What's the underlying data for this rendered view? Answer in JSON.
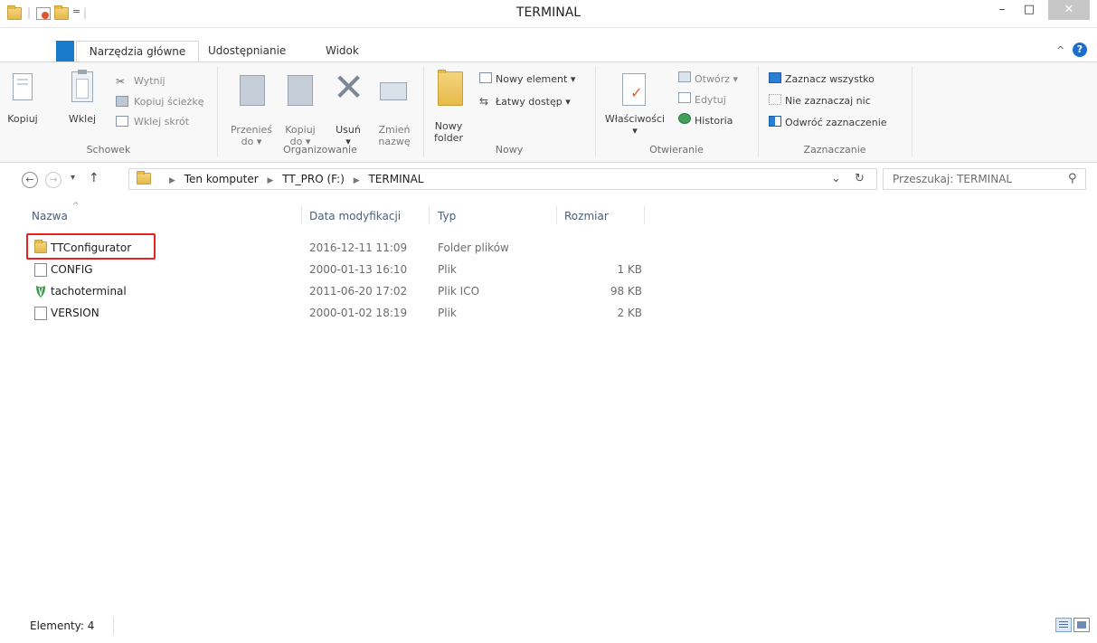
{
  "window": {
    "title": "TERMINAL",
    "minimize_glyph": "–",
    "maximize_glyph": "□",
    "close_glyph": "✕"
  },
  "ribbon_tabs": {
    "home": "Narzędzia główne",
    "share": "Udostępnianie",
    "view": "Widok"
  },
  "ribbon": {
    "clipboard": {
      "copy": "Kopiuj",
      "paste": "Wklej",
      "cut": "Wytnij",
      "copy_path": "Kopiuj ścieżkę",
      "paste_shortcut": "Wklej skrót",
      "group_label": "Schowek"
    },
    "organize": {
      "move_to_1": "Przenieś",
      "move_to_2": "do ▾",
      "copy_to_1": "Kopiuj",
      "copy_to_2": "do ▾",
      "delete_1": "Usuń",
      "delete_2": "▾",
      "rename_1": "Zmień",
      "rename_2": "nazwę",
      "group_label": "Organizowanie"
    },
    "new": {
      "new_folder_1": "Nowy",
      "new_folder_2": "folder",
      "new_item": "Nowy element ▾",
      "easy_access": "Łatwy dostęp ▾",
      "group_label": "Nowy"
    },
    "open": {
      "properties_1": "Właściwości",
      "properties_2": "▾",
      "open": "Otwórz ▾",
      "edit": "Edytuj",
      "history": "Historia",
      "group_label": "Otwieranie"
    },
    "select": {
      "select_all": "Zaznacz wszystko",
      "select_none": "Nie zaznaczaj nic",
      "invert": "Odwróć zaznaczenie",
      "group_label": "Zaznaczanie"
    }
  },
  "nav": {
    "back": "←",
    "forward": "→",
    "recent": "▾",
    "up": "↑",
    "breadcrumb": [
      "Ten komputer",
      "TT_PRO (F:)",
      "TERMINAL"
    ],
    "address_dropdown": "⌄",
    "refresh": "↻",
    "search_placeholder": "Przeszukaj: TERMINAL",
    "search_icon": "⚲"
  },
  "columns": {
    "name": "Nazwa",
    "modified": "Data modyfikacji",
    "type": "Typ",
    "size": "Rozmiar"
  },
  "files": [
    {
      "name": "TTConfigurator",
      "modified": "2016-12-11 11:09",
      "type": "Folder plików",
      "size": "",
      "icon": "folder-icon"
    },
    {
      "name": "CONFIG",
      "modified": "2000-01-13 16:10",
      "type": "Plik",
      "size": "1 KB",
      "icon": "file-icon"
    },
    {
      "name": "tachoterminal",
      "modified": "2011-06-20 17:02",
      "type": "Plik ICO",
      "size": "98 KB",
      "icon": "tacho-ico-icon"
    },
    {
      "name": "VERSION",
      "modified": "2000-01-02 18:19",
      "type": "Plik",
      "size": "2 KB",
      "icon": "file-icon"
    }
  ],
  "status": {
    "items": "Elementy: 4"
  },
  "colors": {
    "accent": "#1979ca",
    "highlight_box": "#e32323",
    "header_text": "#4c607a"
  }
}
